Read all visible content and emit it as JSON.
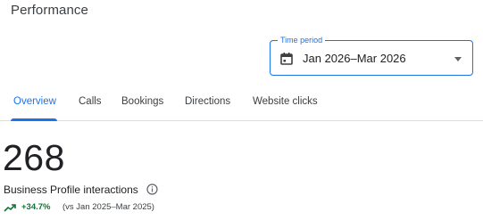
{
  "header": {
    "title": "Performance"
  },
  "time_period": {
    "label": "Time period",
    "value": "Jan 2026–Mar 2026"
  },
  "tabs": [
    {
      "label": "Overview",
      "active": true
    },
    {
      "label": "Calls",
      "active": false
    },
    {
      "label": "Bookings",
      "active": false
    },
    {
      "label": "Directions",
      "active": false
    },
    {
      "label": "Website clicks",
      "active": false
    }
  ],
  "metric": {
    "value": "268",
    "label": "Business Profile interactions",
    "change": "+34.7%",
    "comparison": "(vs Jan 2025–Mar 2025)"
  },
  "colors": {
    "accent": "#1a73e8",
    "positive": "#137333"
  },
  "icons": {
    "calendar": "calendar-icon",
    "dropdown": "dropdown-arrow-icon",
    "info": "info-icon",
    "trend": "trending-up-icon"
  }
}
